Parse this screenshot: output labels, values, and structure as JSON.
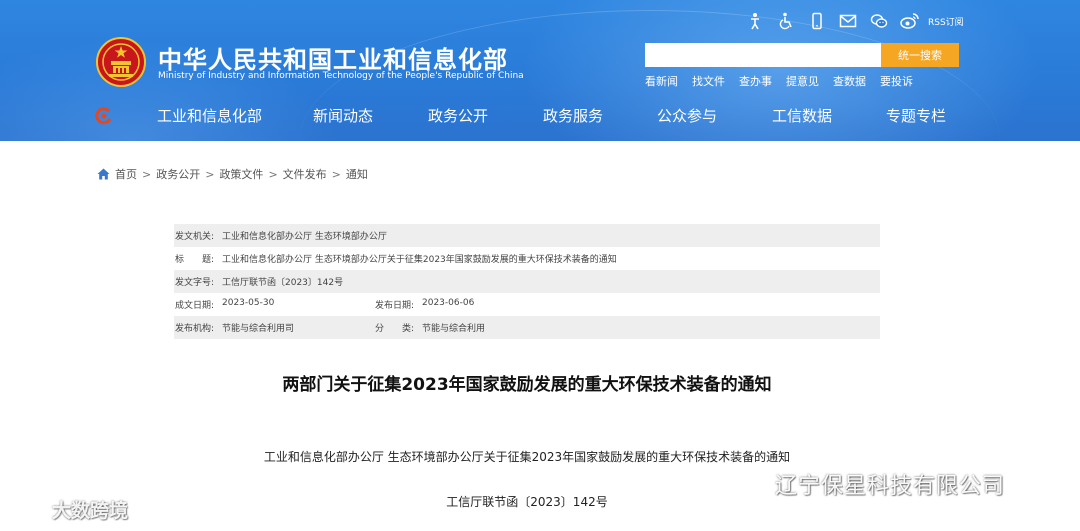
{
  "header": {
    "title_cn": "中华人民共和国工业和信息化部",
    "title_en": "Ministry of Industry and Information Technology of the People's Republic of China",
    "top_icons": [
      "barrier-free-icon",
      "accessibility-icon",
      "mobile-icon",
      "mail-icon",
      "wechat-icon",
      "weibo-icon"
    ],
    "rss_label": "RSS订阅",
    "search": {
      "value": "",
      "placeholder": "",
      "button_label": "统一搜索"
    },
    "quick_links": [
      "看新闻",
      "找文件",
      "查办事",
      "提意见",
      "查数据",
      "要投诉"
    ],
    "nav": [
      "工业和信息化部",
      "新闻动态",
      "政务公开",
      "政务服务",
      "公众参与",
      "工信数据",
      "专题专栏"
    ],
    "colors": {
      "header_blue": "#2a7bd8",
      "search_button": "#f5a623",
      "info_row_gray": "#eeeeee"
    }
  },
  "breadcrumb": [
    "首页",
    "政务公开",
    "政策文件",
    "文件发布",
    "通知"
  ],
  "info": {
    "issuer_label": "发文机关:",
    "issuer_value": "工业和信息化部办公厅 生态环境部办公厅",
    "title_label": "标　　题:",
    "title_value": "工业和信息化部办公厅 生态环境部办公厅关于征集2023年国家鼓励发展的重大环保技术装备的通知",
    "docno_label": "发文字号:",
    "docno_value": "工信厅联节函〔2023〕142号",
    "created_label": "成文日期:",
    "created_value": "2023-05-30",
    "published_label": "发布日期:",
    "published_value": "2023-06-06",
    "org_label": "发布机构:",
    "org_value": "节能与综合利用司",
    "category_label": "分　　类:",
    "category_value": "节能与综合利用"
  },
  "article": {
    "title": "两部门关于征集2023年国家鼓励发展的重大环保技术装备的通知",
    "subtitle": "工业和信息化部办公厅 生态环境部办公厅关于征集2023年国家鼓励发展的重大环保技术装备的通知",
    "doc_number": "工信厅联节函〔2023〕142号"
  },
  "watermarks": {
    "left": "大数跨境",
    "right": "辽宁保星科技有限公司"
  }
}
